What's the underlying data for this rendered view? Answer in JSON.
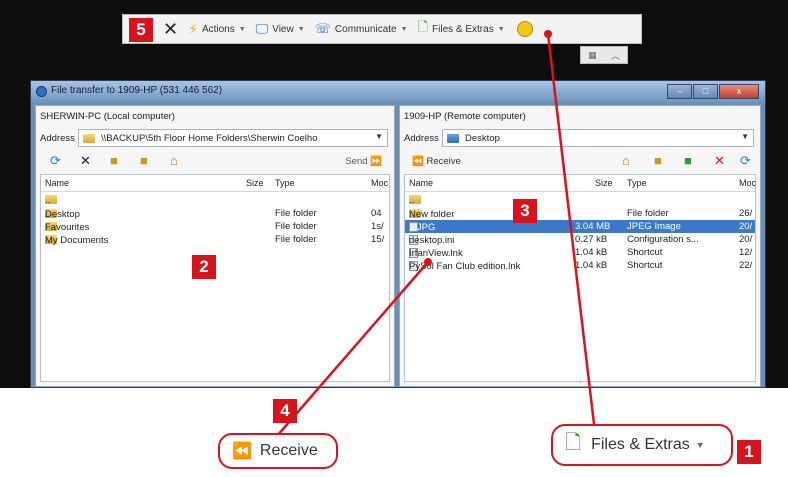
{
  "toolbar": {
    "actions": "Actions",
    "view": "View",
    "communicate": "Communicate",
    "files_extras": "Files & Extras"
  },
  "window": {
    "title": "File transfer to 1909-HP (531 446 562)",
    "minimize": "–",
    "maximize": "□",
    "close": "x"
  },
  "local": {
    "header": "SHERWIN-PC (Local computer)",
    "address_label": "Address",
    "address_value": "\\\\BACKUP\\5th Floor Home Folders\\Sherwin Coelho",
    "send_label": "Send",
    "columns": [
      "Name",
      "Size",
      "Type",
      "Moc"
    ],
    "rows": [
      {
        "name": "..",
        "size": "",
        "type": "",
        "mod": ""
      },
      {
        "name": "Desktop",
        "size": "",
        "type": "File folder",
        "mod": "04"
      },
      {
        "name": "Favourites",
        "size": "",
        "type": "File folder",
        "mod": "1s/"
      },
      {
        "name": "My Documents",
        "size": "",
        "type": "File folder",
        "mod": "15/"
      }
    ]
  },
  "remote": {
    "header": "1909-HP (Remote computer)",
    "address_label": "Address",
    "address_value": "Desktop",
    "receive_label": "Receive",
    "columns": [
      "Name",
      "Size",
      "Type",
      "Moc"
    ],
    "rows": [
      {
        "name": "..",
        "size": "",
        "type": "",
        "mod": ""
      },
      {
        "name": "New folder",
        "size": "",
        "type": "File folder",
        "mod": "26/"
      },
      {
        "name": "1.JPG",
        "size": "3.04 MB",
        "type": "JPEG Image",
        "mod": "20/"
      },
      {
        "name": "desktop.ini",
        "size": "0.27 kB",
        "type": "Configuration s...",
        "mod": "20/"
      },
      {
        "name": "IrfanView.lnk",
        "size": "1.04 kB",
        "type": "Shortcut",
        "mod": "12/"
      },
      {
        "name": "PySol Fan Club edition.lnk",
        "size": "1.04 kB",
        "type": "Shortcut",
        "mod": "22/"
      }
    ]
  },
  "callouts": {
    "receive": "Receive",
    "files_extras": "Files & Extras"
  },
  "badges": {
    "one": "1",
    "two": "2",
    "three": "3",
    "four": "4",
    "five": "5"
  },
  "colors": {
    "badge": "#d7141e",
    "selection": "#3c79c9",
    "screen": "#0d0d0d"
  },
  "icons": [
    "close-icon",
    "lightning-icon",
    "monitor-icon",
    "phone-icon",
    "file-transfer-icon",
    "smiley-icon",
    "grid-icon",
    "chevron-up-icon",
    "refresh-icon",
    "delete-icon",
    "new-folder-icon",
    "home-icon",
    "receive-arrow-icon",
    "send-arrow-icon"
  ]
}
